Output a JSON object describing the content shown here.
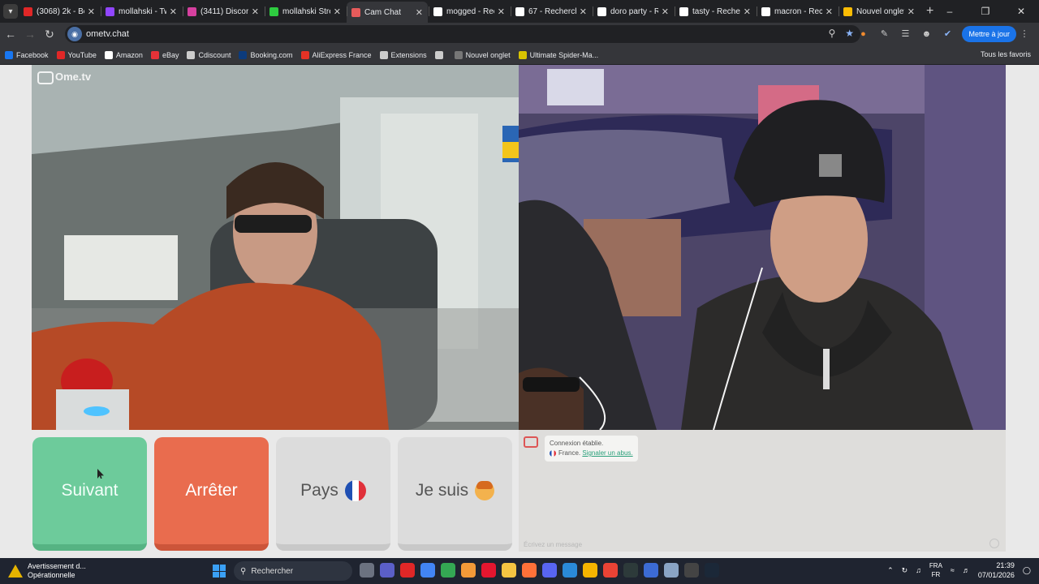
{
  "browser": {
    "tabs": [
      {
        "label": "(3068) 2k - Bo",
        "color": "#e02727"
      },
      {
        "label": "mollahski - Tw",
        "color": "#9146ff"
      },
      {
        "label": "(3411) Discord",
        "color": "#d6409f"
      },
      {
        "label": "mollahski Strea",
        "color": "#2ecc40"
      },
      {
        "label": "Cam Chat",
        "color": "#e65b5b"
      },
      {
        "label": "mogged - Rech",
        "color": "#ffffff"
      },
      {
        "label": "67 - Recherche",
        "color": "#ffffff"
      },
      {
        "label": "doro party - Re",
        "color": "#ffffff"
      },
      {
        "label": "tasty - Recherc",
        "color": "#ffffff"
      },
      {
        "label": "macron - Rech",
        "color": "#ffffff"
      },
      {
        "label": "Nouvel onglet",
        "color": "#fbbc04"
      }
    ],
    "new_tab": "+",
    "url": "ometv.chat",
    "update_button": "Mettre à jour",
    "bookmarks": [
      {
        "label": "Facebook",
        "color": "#1877f2"
      },
      {
        "label": "YouTube",
        "color": "#e02727"
      },
      {
        "label": "Amazon",
        "color": "#ffffff"
      },
      {
        "label": "eBay",
        "color": "#e53238"
      },
      {
        "label": "Cdiscount",
        "color": "#cccccc"
      },
      {
        "label": "Booking.com",
        "color": "#0c3b7c"
      },
      {
        "label": "AliExpress France",
        "color": "#e43225"
      },
      {
        "label": "Extensions",
        "color": "#cccccc"
      },
      {
        "label": "",
        "color": "#cccccc"
      },
      {
        "label": "Nouvel onglet",
        "color": "#777777"
      },
      {
        "label": "Ultimate Spider-Ma...",
        "color": "#d9c400"
      }
    ],
    "all_bookmarks": "Tous les favoris"
  },
  "site": {
    "logo": "Ome.tv",
    "buttons": {
      "next": "Suivant",
      "stop": "Arrêter",
      "country": "Pays",
      "iam": "Je suis"
    },
    "chat": {
      "status": "Connexion établie.",
      "country": "France.",
      "report": "Signaler un abus.",
      "input_placeholder": "Écrivez un message"
    }
  },
  "taskbar": {
    "notice_title": "Avertissement d...",
    "notice_sub": "Opérationnelle",
    "search": "Rechercher",
    "lang_top": "FRA",
    "lang_bottom": "FR",
    "time": "21:39",
    "date": "07/01/2026"
  }
}
